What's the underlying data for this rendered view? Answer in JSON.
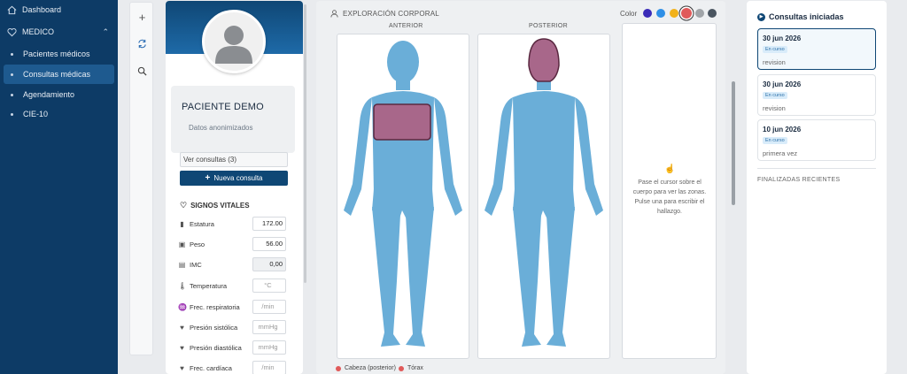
{
  "sidebar": {
    "items": [
      {
        "label": "Dashboard",
        "icon": "home-icon"
      },
      {
        "label": "MEDICO",
        "icon": "heart-icon"
      },
      {
        "label": "Pacientes médicos"
      },
      {
        "label": "Consultas médicas",
        "active": true
      },
      {
        "label": "Agendamiento"
      },
      {
        "label": "CIE-10"
      }
    ],
    "colors": {
      "bg": "#0d3b66",
      "active": "#1e5a8f"
    }
  },
  "tools": [
    {
      "icon": "plus-icon",
      "glyph": "+"
    },
    {
      "icon": "refresh-icon",
      "glyph": "⟲"
    },
    {
      "icon": "search-icon",
      "glyph": "⌕"
    }
  ],
  "patient": {
    "name": "PACIENTE DEMO",
    "subtitle": "Datos anonimizados",
    "ver_consultas": "Ver consultas (3)",
    "nueva_consulta": "Nueva consulta",
    "vitals_title": "SIGNOS VITALES",
    "vitals": [
      {
        "label": "Estatura",
        "icon": "ruler-icon",
        "glyph": "▮",
        "value": "172.00",
        "placeholder": false
      },
      {
        "label": "Peso",
        "icon": "scale-icon",
        "glyph": "▣",
        "value": "56.00",
        "placeholder": false
      },
      {
        "label": "IMC",
        "icon": "calculator-icon",
        "glyph": "▤",
        "value": "0,00",
        "placeholder": false,
        "readonly": true
      },
      {
        "label": "Temperatura",
        "icon": "thermometer-icon",
        "glyph": "🌡",
        "value": "°C",
        "placeholder": true
      },
      {
        "label": "Frec. respiratoria",
        "icon": "lungs-icon",
        "glyph": "♒",
        "value": "/min",
        "placeholder": true
      },
      {
        "label": "Presión sistólica",
        "icon": "heartbeat-icon",
        "glyph": "♥",
        "value": "mmHg",
        "placeholder": true
      },
      {
        "label": "Presión diastólica",
        "icon": "heartbeat-icon",
        "glyph": "♥",
        "value": "mmHg",
        "placeholder": true
      },
      {
        "label": "Frec. cardíaca",
        "icon": "heart-icon",
        "glyph": "♥",
        "value": "/min",
        "placeholder": true
      }
    ]
  },
  "exploracion": {
    "title": "EXPLORACIÓN CORPORAL",
    "color_label": "Color",
    "colors": [
      "#3a2bb8",
      "#2f8fe6",
      "#f2b21b",
      "#e05a5a",
      "#a0a4a8",
      "#4a5560"
    ],
    "selected_color": "#e05a5a",
    "anterior_label": "ANTERIOR",
    "posterior_label": "POSTERIOR",
    "body_color": "#6aaed8",
    "highlight_color": "#a8678a",
    "hint": "Pase el cursor sobre el cuerpo para ver las zonas. Pulse una para escribir el hallazgo.",
    "legend": [
      "Cabeza (posterior)",
      "Tórax"
    ]
  },
  "consultas": {
    "title": "Consultas iniciadas",
    "items": [
      {
        "date": "30 jun 2026",
        "status": "En curso",
        "type": "revision",
        "selected": true
      },
      {
        "date": "30 jun 2026",
        "status": "En curso",
        "type": "revision",
        "selected": false
      },
      {
        "date": "10 jun 2026",
        "status": "En curso",
        "type": "primera vez",
        "selected": false
      }
    ],
    "finalizadas_title": "FINALIZADAS RECIENTES"
  }
}
